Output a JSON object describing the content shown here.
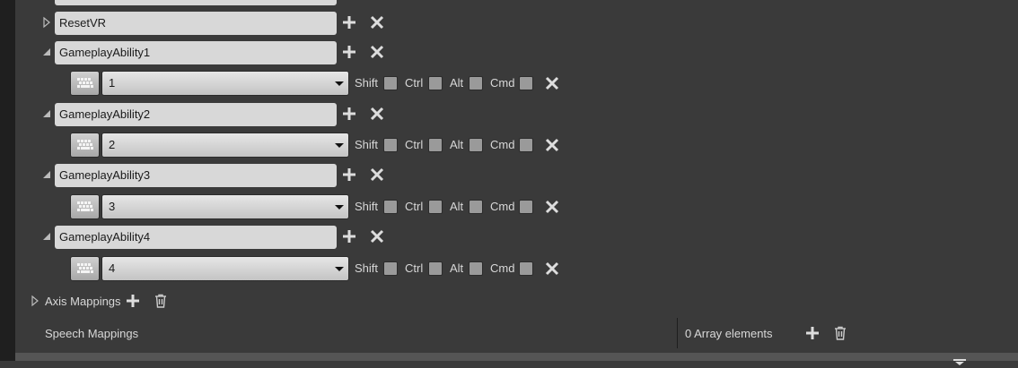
{
  "actions": [
    {
      "name": "ResetVR",
      "expanded": false
    },
    {
      "name": "GameplayAbility1",
      "expanded": true,
      "key": "1"
    },
    {
      "name": "GameplayAbility2",
      "expanded": true,
      "key": "2"
    },
    {
      "name": "GameplayAbility3",
      "expanded": true,
      "key": "3"
    },
    {
      "name": "GameplayAbility4",
      "expanded": true,
      "key": "4"
    }
  ],
  "modifiers": {
    "shift": "Shift",
    "ctrl": "Ctrl",
    "alt": "Alt",
    "cmd": "Cmd"
  },
  "axis_mappings": {
    "label": "Axis Mappings",
    "expanded": false
  },
  "speech_mappings": {
    "label": "Speech Mappings",
    "count_text": "0 Array elements"
  },
  "icons": {
    "add": "plus-icon",
    "remove": "close-icon",
    "delete": "trash-icon",
    "key_selector": "keyboard-icon"
  },
  "colors": {
    "background": "#3a3a3a",
    "field": "#d8d8d8",
    "sidebar": "#1f1f1f"
  }
}
